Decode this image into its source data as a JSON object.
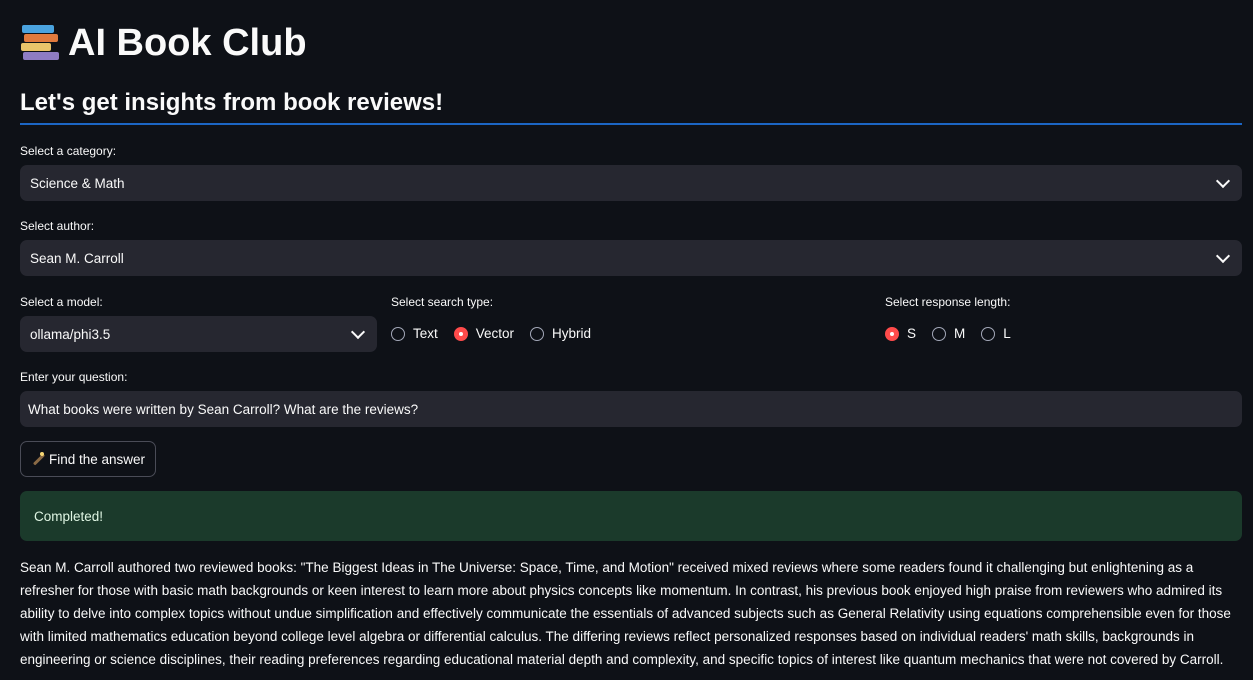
{
  "app": {
    "title": "AI Book Club",
    "subheader": "Let's get insights from book reviews!"
  },
  "category": {
    "label": "Select a category:",
    "value": "Science & Math"
  },
  "author": {
    "label": "Select author:",
    "value": "Sean M. Carroll"
  },
  "model": {
    "label": "Select a model:",
    "value": "ollama/phi3.5"
  },
  "search_type": {
    "label": "Select search type:",
    "options": [
      "Text",
      "Vector",
      "Hybrid"
    ],
    "selected": "Vector"
  },
  "response_length": {
    "label": "Select response length:",
    "options": [
      "S",
      "M",
      "L"
    ],
    "selected": "S"
  },
  "question": {
    "label": "Enter your question:",
    "value": "What books were written by Sean Carroll? What are the reviews?"
  },
  "find_button": {
    "label": "Find the answer"
  },
  "status": {
    "message": "Completed!"
  },
  "answer": {
    "text": "Sean M. Carroll authored two reviewed books: \"The Biggest Ideas in The Universe: Space, Time, and Motion\" received mixed reviews where some readers found it challenging but enlightening as a refresher for those with basic math backgrounds or keen interest to learn more about physics concepts like momentum. In contrast, his previous book enjoyed high praise from reviewers who admired its ability to delve into complex topics without undue simplification and effectively communicate the essentials of advanced subjects such as General Relativity using equations comprehensible even for those with limited mathematics education beyond college level algebra or differential calculus. The differing reviews reflect personalized responses based on individual readers' math skills, backgrounds in engineering or science disciplines, their reading preferences regarding educational material depth and complexity, and specific topics of interest like quantum mechanics that were not covered by Carroll."
  },
  "colors": {
    "background": "#0e1117",
    "widget_bg": "#262730",
    "accent": "#ff4b4b",
    "divider": "#1c66c4",
    "success_bg": "#1b3a2b"
  },
  "icons": {
    "title": "books-icon",
    "button": "magic-wand-icon"
  }
}
